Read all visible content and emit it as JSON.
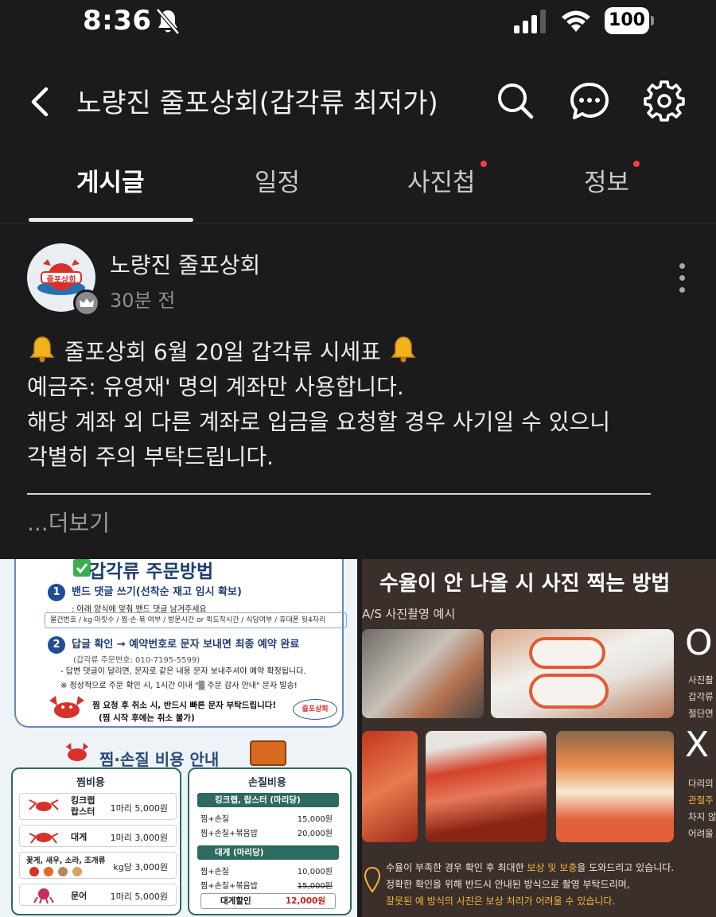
{
  "status_bar": {
    "time": "8:36",
    "battery": "100",
    "icons": [
      "bell-slash-icon",
      "signal-icon",
      "wifi-icon",
      "battery-icon"
    ]
  },
  "header": {
    "title": "노량진 줄포상회(갑각류 최저가)",
    "icons": [
      "back-icon",
      "search-icon",
      "chat-icon",
      "gear-icon"
    ]
  },
  "tabs": [
    {
      "label": "게시글",
      "active": true,
      "dot": false
    },
    {
      "label": "일정",
      "active": false,
      "dot": false
    },
    {
      "label": "사진첩",
      "active": false,
      "dot": true
    },
    {
      "label": "정보",
      "active": false,
      "dot": true
    }
  ],
  "post": {
    "author": "노량진 줄포상회",
    "time": "30분 전",
    "avatar_text": "줄포상회",
    "lines": [
      "줄포상회 6월 20일 갑각류 시세표",
      "예금주: 유영재' 명의 계좌만 사용합니다.",
      "해당 계좌 외 다른 계좌로 입금을 요청할 경우 사기일 수 있으니",
      "각별히 주의 부탁드립니다."
    ],
    "see_more": "...더보기"
  },
  "image_left": {
    "order_title": "갑각류 주문방법",
    "step1": "밴드 댓글 쓰기(선착순 재고 임시 확보)",
    "step1_note": ": 아래 양식에 맞춰 밴드 댓글 남겨주세요",
    "form_fields": "물건번호 / kg·마릿수 / 찜·손·볶 여부 / 방문시간 or 퀵도착시간 / 식당여부 / 휴대폰 뒷4자리",
    "step2": "답글 확인 → 예약번호로 문자 보내면 최종 예약 완료",
    "step2_sub": "(갑각류 주문번호: 010-7195-5599)",
    "step2_note": "- 답변 댓글이 달리면, 문자로 같은 내용 문자 보내주셔야 예약 확정됩니다.",
    "notice": "※ 정상적으로 주문 확인 시, 1시간 이내 \"▒ 주문 감사 안내\" 문자 발송!",
    "cancel_1": "찜 요청 후 취소 시, 반드시 빠른 문자 부탁드립니다!",
    "cancel_2": "(찜 시작 후에는 취소 불가)",
    "stamp_text": "줄포상회",
    "cost_title": "찜·손질 비용 안내",
    "steam_head": "찜비용",
    "steam_rows": [
      {
        "name": "킹크랩\n랍스터",
        "price": "1마리 5,000원"
      },
      {
        "name": "대게",
        "price": "1마리 3,000원"
      },
      {
        "name": "꽃게, 새우, 소라, 조개류",
        "price": "kg당 3,000원"
      },
      {
        "name": "문어",
        "price": "1마리 5,000원"
      }
    ],
    "trim_head": "손질비용",
    "trim_band_1": "킹크랩, 랍스터 (마리당)",
    "trim_rows_1": [
      {
        "name": "찜+손질",
        "price": "15,000원"
      },
      {
        "name": "찜+손질+볶음밥",
        "price": "20,000원"
      }
    ],
    "trim_band_2": "대게 (마리당)",
    "trim_rows_2": [
      {
        "name": "찜+손질",
        "price": "10,000원"
      },
      {
        "name": "찜+손질+볶음밥",
        "price": "15,000원"
      }
    ],
    "discount_label": "대게할인",
    "discount_price": "12,000원"
  },
  "image_right": {
    "title": "수율이 안 나올 시 사진 찍는 방법",
    "subtitle": "A/S 사진촬영 예시",
    "ok_mark": "O",
    "no_mark": "X",
    "ok_text": [
      "사진촬",
      "갑각류",
      "절단면"
    ],
    "no_text": [
      "다리의",
      "관절주",
      "차지 않",
      "어려울"
    ],
    "foot_1a": "수율이 부족한 경우 확인 후 최대한 ",
    "foot_1b": "보상 및 보충",
    "foot_1c": "을 도와드리고 있습니다.",
    "foot_2": "정확한 확인을 위해 반드시 안내된 방식으로 촬영 부탁드리며,",
    "foot_3a": "잘못된 예 방식의 사진은 보상 처리가 어려울 수 있습니다."
  }
}
